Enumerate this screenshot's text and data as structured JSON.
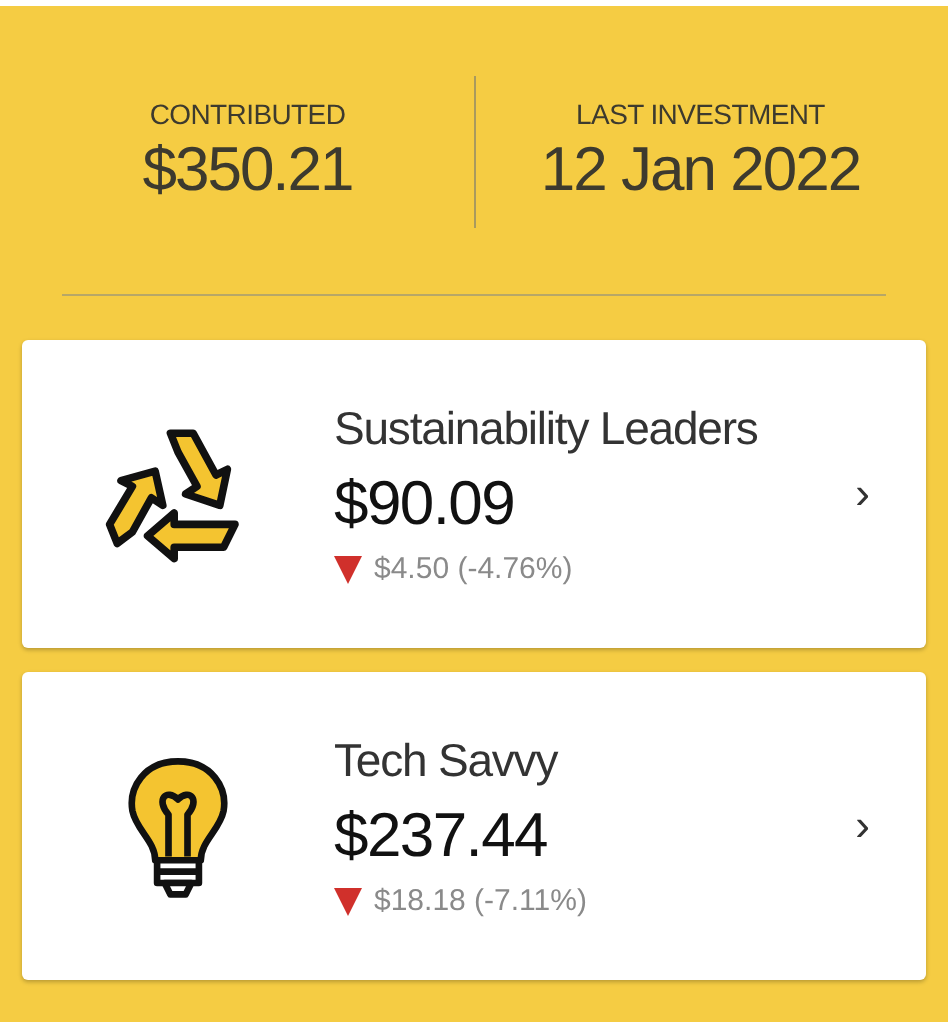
{
  "summary": [
    {
      "label": "CONTRIBUTED",
      "value": "$350.21"
    },
    {
      "label": "LAST INVESTMENT",
      "value": "12 Jan 2022"
    }
  ],
  "funds": [
    {
      "kind": "recycle",
      "name": "Sustainability Leaders",
      "value": "$90.09",
      "decreasing": true,
      "change": "$4.50 (-4.76%)",
      "chevron": "›"
    },
    {
      "kind": "bulb",
      "name": "Tech Savvy",
      "value": "$237.44",
      "decreasing": true,
      "change": "$18.18 (-7.11%)",
      "chevron": "›"
    }
  ]
}
